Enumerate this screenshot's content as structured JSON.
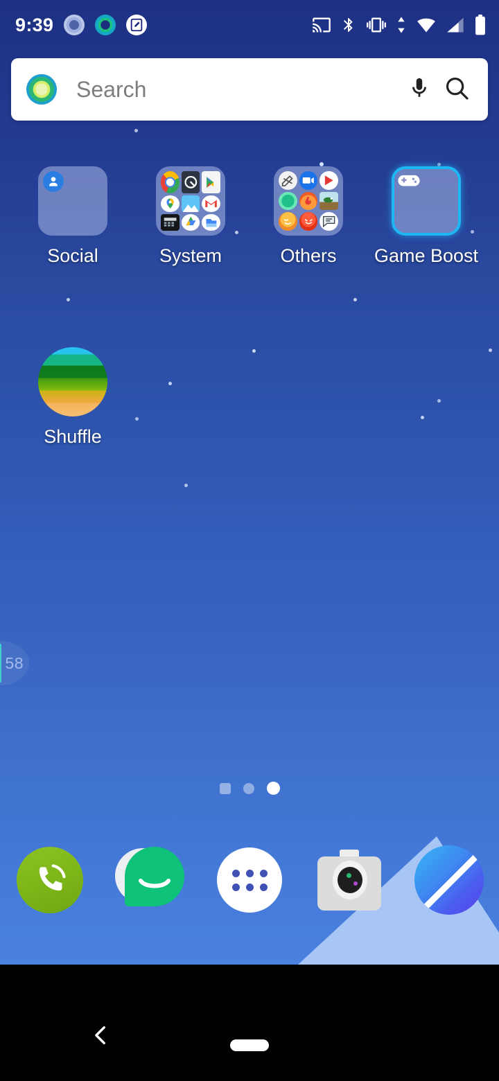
{
  "status_bar": {
    "time": "9:39",
    "left_icons": [
      {
        "name": "notification-ring-grey-icon",
        "label": "notification"
      },
      {
        "name": "assistant-ring-cyan-icon",
        "label": "assistant"
      },
      {
        "name": "screenshot-markup-icon",
        "label": "screenshot"
      }
    ],
    "right_icons": [
      {
        "name": "cast-screen-icon",
        "label": "cast"
      },
      {
        "name": "bluetooth-icon",
        "label": "bluetooth"
      },
      {
        "name": "vibrate-mode-icon",
        "label": "vibrate"
      },
      {
        "name": "data-transfer-icon",
        "label": "data"
      },
      {
        "name": "wifi-icon",
        "label": "wifi"
      },
      {
        "name": "cellular-signal-icon",
        "label": "signal"
      },
      {
        "name": "battery-icon",
        "label": "battery"
      }
    ]
  },
  "search": {
    "placeholder": "Search",
    "logo": "google-logo-icon",
    "mic": "microphone-icon",
    "magnifier": "search-icon"
  },
  "edge_widget": {
    "value": "58",
    "accent_color": "#3fd0c9"
  },
  "home": {
    "folders": [
      {
        "label": "Social",
        "type": "folder",
        "selected": false,
        "apps": [
          "contacts-icon"
        ]
      },
      {
        "label": "System",
        "type": "folder",
        "selected": false,
        "apps": [
          "chrome-icon",
          "clock-settings-icon",
          "play-store-icon",
          "maps-icon",
          "photos-icon",
          "gmail-icon",
          "calculator-icon",
          "drive-icon",
          "files-icon"
        ]
      },
      {
        "label": "Others",
        "type": "folder",
        "selected": false,
        "apps": [
          "sketch-icon",
          "video-call-icon",
          "play-music-icon",
          "green-app-icon",
          "flame-app-icon",
          "pixel-game-icon",
          "orange-face-icon",
          "red-face-icon",
          "chat-bubble-icon"
        ]
      },
      {
        "label": "Game Boost",
        "type": "folder",
        "selected": true,
        "selected_color": "#1eb7f5",
        "apps": [
          "gamepad-icon"
        ]
      }
    ],
    "apps": [
      {
        "label": "Shuffle",
        "type": "app",
        "icon": "shuffle-icon"
      }
    ]
  },
  "page_indicator": {
    "pages": [
      {
        "state": "square"
      },
      {
        "state": "dim"
      },
      {
        "state": "active"
      }
    ],
    "current": 3,
    "total": 3
  },
  "dock": {
    "items": [
      {
        "name": "phone-icon",
        "label": "Phone"
      },
      {
        "name": "messages-icon",
        "label": "Messages"
      },
      {
        "name": "app-drawer-icon",
        "label": "All apps"
      },
      {
        "name": "camera-icon",
        "label": "Camera"
      },
      {
        "name": "browser-icon",
        "label": "Browser"
      }
    ]
  },
  "nav_bar": {
    "back": "back-icon",
    "home": "home-pill-indicator"
  }
}
